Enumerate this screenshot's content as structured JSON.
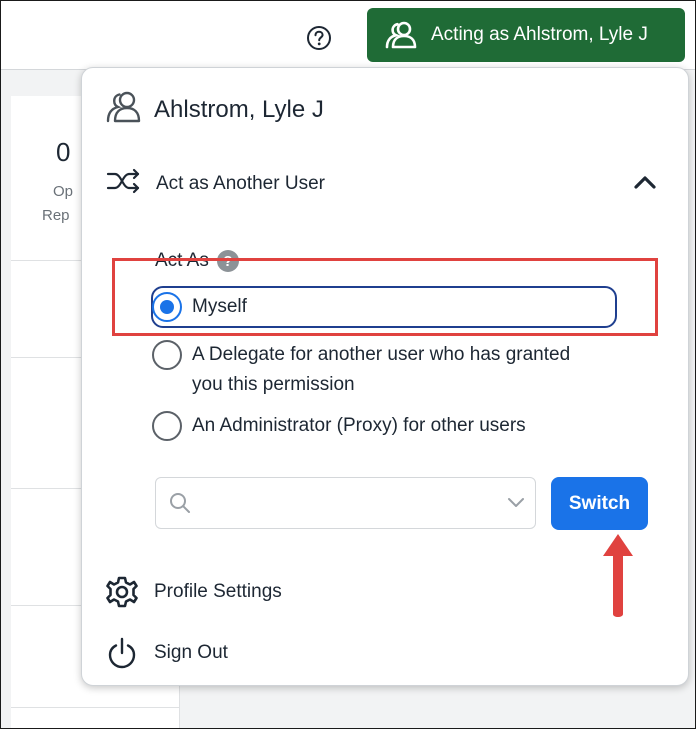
{
  "header": {
    "help_icon": "help-circle-icon",
    "acting_label": "Acting as Ahlstrom, Lyle J",
    "acting_icon": "users-icon",
    "accent_color": "#1f6b36"
  },
  "background": {
    "stat_value": "0",
    "stat_label_line1": "Op",
    "stat_label_line2": "Rep"
  },
  "popover": {
    "user_name": "Ahlstrom, Lyle J",
    "user_icon": "users-icon",
    "act_as_another": "Act as Another User",
    "act_as_icon": "shuffle-icon",
    "act_as_label": "Act As",
    "options": [
      {
        "label": "Myself",
        "selected": true
      },
      {
        "label": "A Delegate for another user who has granted",
        "label2": "you this permission",
        "selected": false
      },
      {
        "label": "An Administrator (Proxy) for other users",
        "selected": false
      }
    ],
    "search": {
      "value": "",
      "placeholder": ""
    },
    "switch_label": "Switch",
    "switch_color": "#1a73e8",
    "profile_settings": "Profile Settings",
    "sign_out": "Sign Out"
  },
  "annotations": {
    "highlight_color": "#e0423f"
  }
}
